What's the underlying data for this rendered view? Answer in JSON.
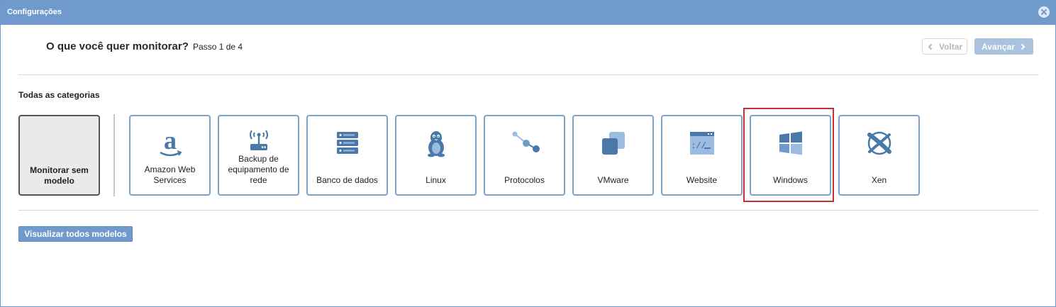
{
  "window": {
    "title": "Configurações"
  },
  "header": {
    "question": "O que você quer monitorar?",
    "step": "Passo 1 de 4",
    "back_label": "Voltar",
    "next_label": "Avançar"
  },
  "categories": {
    "heading": "Todas as categorias",
    "blank_tile": "Monitorar sem modelo",
    "tiles": [
      {
        "label": "Amazon Web Services",
        "icon": "amazon-icon"
      },
      {
        "label": "Backup de equipamento de rede",
        "icon": "router-icon"
      },
      {
        "label": "Banco de dados",
        "icon": "database-icon"
      },
      {
        "label": "Linux",
        "icon": "linux-penguin-icon"
      },
      {
        "label": "Protocolos",
        "icon": "protocol-nodes-icon"
      },
      {
        "label": "VMware",
        "icon": "vmware-icon"
      },
      {
        "label": "Website",
        "icon": "website-icon"
      },
      {
        "label": "Windows",
        "icon": "windows-icon"
      },
      {
        "label": "Xen",
        "icon": "xen-icon"
      }
    ],
    "selected": "Windows"
  },
  "footer": {
    "view_all_label": "Visualizar todos modelos"
  },
  "colors": {
    "titlebar": "#6f9acb",
    "tile_border": "#7ba3c8",
    "icon": "#4a78a8",
    "highlight": "#c9302c"
  }
}
